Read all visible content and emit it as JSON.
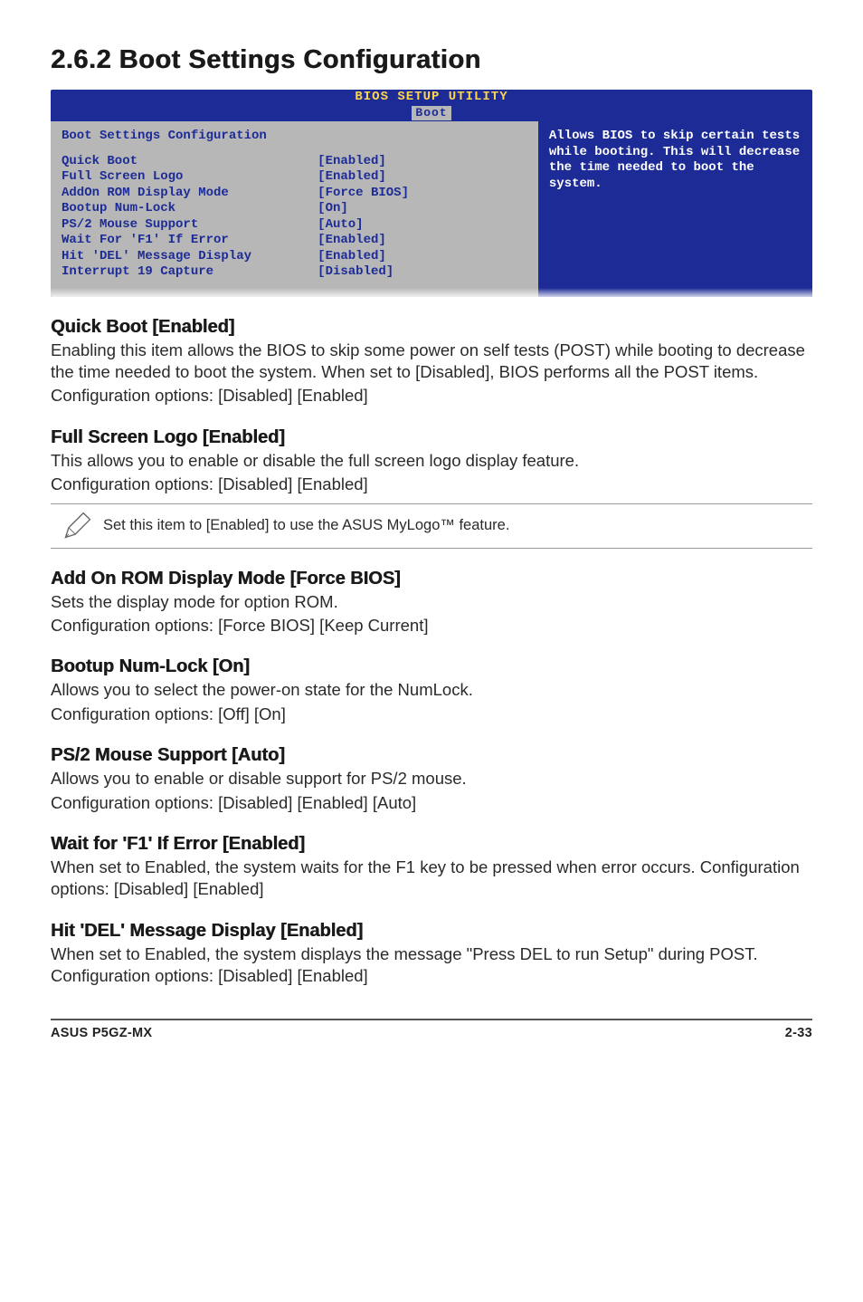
{
  "title": "2.6.2   Boot Settings Configuration",
  "bios": {
    "title_top": "BIOS SETUP UTILITY",
    "tab": "Boot",
    "left_heading": "Boot Settings Configuration",
    "rows": [
      {
        "label": "Quick Boot",
        "value": "[Enabled]"
      },
      {
        "label": "Full Screen Logo",
        "value": "[Enabled]"
      },
      {
        "label": "AddOn ROM Display Mode",
        "value": "[Force BIOS]"
      },
      {
        "label": "Bootup Num-Lock",
        "value": "[On]"
      },
      {
        "label": "PS/2 Mouse Support",
        "value": "[Auto]"
      },
      {
        "label": "Wait For 'F1' If Error",
        "value": "[Enabled]"
      },
      {
        "label": "Hit 'DEL' Message Display",
        "value": "[Enabled]"
      },
      {
        "label": "Interrupt 19 Capture",
        "value": "[Disabled]"
      }
    ],
    "help": "Allows BIOS to skip certain tests while booting. This will decrease the time needed to boot the system."
  },
  "sections": [
    {
      "heading": "Quick Boot [Enabled]",
      "body": "Enabling this item allows the BIOS to skip some power on self tests (POST) while booting to decrease the time needed to boot the system. When set to [Disabled], BIOS performs all the POST items.",
      "config": "Configuration options: [Disabled] [Enabled]"
    },
    {
      "heading": "Full Screen Logo [Enabled]",
      "body": "This allows you to enable or disable the full screen logo display feature.",
      "config": "Configuration options: [Disabled] [Enabled]",
      "note": "Set this item to [Enabled] to use the ASUS MyLogo™ feature."
    },
    {
      "heading": "Add On ROM Display Mode [Force BIOS]",
      "body": "Sets the display mode for option ROM.",
      "config": "Configuration options: [Force BIOS] [Keep Current]"
    },
    {
      "heading": "Bootup Num-Lock [On]",
      "body": "Allows you to select the power-on state for the NumLock.",
      "config": "Configuration options: [Off] [On]"
    },
    {
      "heading": "PS/2 Mouse Support [Auto]",
      "body": "Allows you to enable or disable support for PS/2 mouse.",
      "config": "Configuration options: [Disabled] [Enabled] [Auto]"
    },
    {
      "heading": "Wait for 'F1' If Error [Enabled]",
      "body": "When set to Enabled, the system waits for the F1 key to be pressed when error occurs. Configuration options: [Disabled] [Enabled]"
    },
    {
      "heading": "Hit 'DEL' Message Display [Enabled]",
      "body": "When set to Enabled, the system displays the message \"Press DEL to run Setup\" during POST. Configuration options: [Disabled] [Enabled]"
    }
  ],
  "footer": {
    "left": "ASUS P5GZ-MX",
    "right": "2-33"
  }
}
